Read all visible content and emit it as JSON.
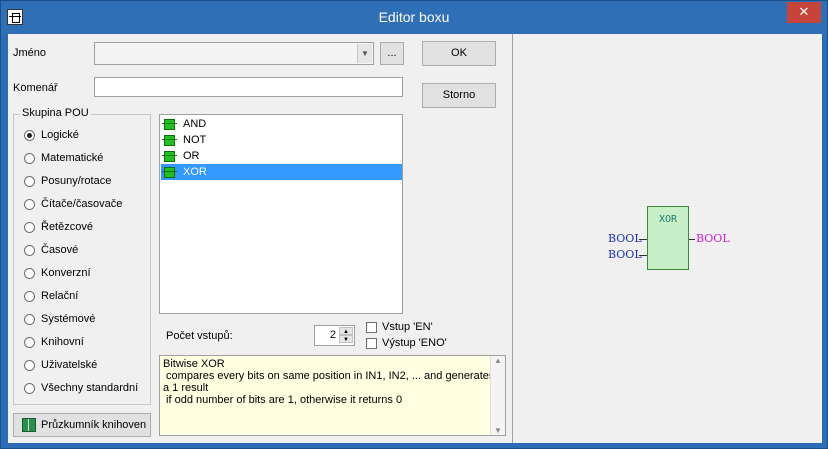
{
  "window": {
    "title": "Editor boxu",
    "close_glyph": "✕"
  },
  "form": {
    "name_label": "Jméno",
    "name_value": "",
    "browse_label": "...",
    "comment_label": "Komenář",
    "comment_value": "",
    "ok_label": "OK",
    "cancel_label": "Storno"
  },
  "group": {
    "title": "Skupina POU",
    "options": [
      {
        "label": "Logické",
        "checked": true
      },
      {
        "label": "Matematické",
        "checked": false
      },
      {
        "label": "Posuny/rotace",
        "checked": false
      },
      {
        "label": "Čítače/časovače",
        "checked": false
      },
      {
        "label": "Řetězcové",
        "checked": false
      },
      {
        "label": "Časové",
        "checked": false
      },
      {
        "label": "Konverzní",
        "checked": false
      },
      {
        "label": "Relační",
        "checked": false
      },
      {
        "label": "Systémové",
        "checked": false
      },
      {
        "label": "Knihovní",
        "checked": false
      },
      {
        "label": "Uživatelské",
        "checked": false
      },
      {
        "label": "Všechny standardní",
        "checked": false
      }
    ]
  },
  "list": {
    "items": [
      "AND",
      "NOT",
      "OR",
      "XOR"
    ],
    "selected": "XOR",
    "icon": "function-block-icon"
  },
  "inputs": {
    "count_label": "Počet vstupů:",
    "count_value": "2",
    "en_label": "Vstup 'EN'",
    "eno_label": "Výstup 'ENO'"
  },
  "description": {
    "lines": [
      "Bitwise XOR",
      " compares every bits on same position in IN1, IN2, ... and generates",
      "a 1 result",
      " if odd number of bits are 1, otherwise it returns 0"
    ]
  },
  "explorer_button": {
    "label": "Průzkumník knihoven",
    "icon": "book-icon"
  },
  "preview": {
    "block_name": "XOR",
    "inputs": [
      "BOOL",
      "BOOL"
    ],
    "output": "BOOL",
    "colors": {
      "block_fill": "#c8f0c8",
      "block_title": "#1f7a6e",
      "input_type": "#1f2fb8",
      "output_type": "#d21fd2"
    }
  }
}
